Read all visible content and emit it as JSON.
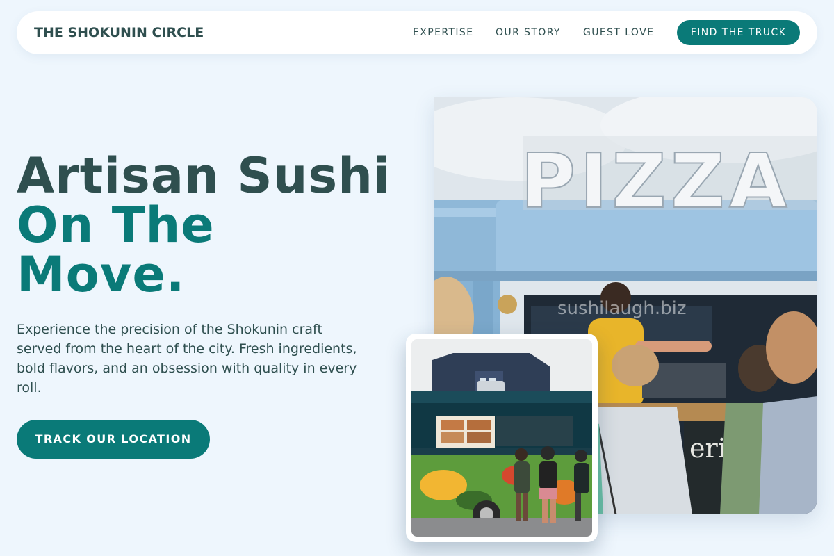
{
  "header": {
    "brand": "THE SHOKUNIN CIRCLE",
    "nav": [
      "EXPERTISE",
      "OUR STORY",
      "GUEST LOVE"
    ],
    "cta": "FIND THE TRUCK"
  },
  "hero": {
    "title_line1": "Artisan Sushi",
    "title_line2": "On The",
    "title_line3": "Move.",
    "description": "Experience the precision of the Shokunin craft served from the heart of the city. Fresh ingredients, bold flavors, and an obsession with quality in every roll.",
    "cta": "TRACK OUR LOCATION"
  },
  "images": {
    "main_sign": "PIZZA",
    "main_watermark": "sushilaugh.biz",
    "board_text": "erit"
  },
  "colors": {
    "accent": "#0a7a78",
    "heading": "#2f4f4f",
    "background": "#eef6fd"
  }
}
